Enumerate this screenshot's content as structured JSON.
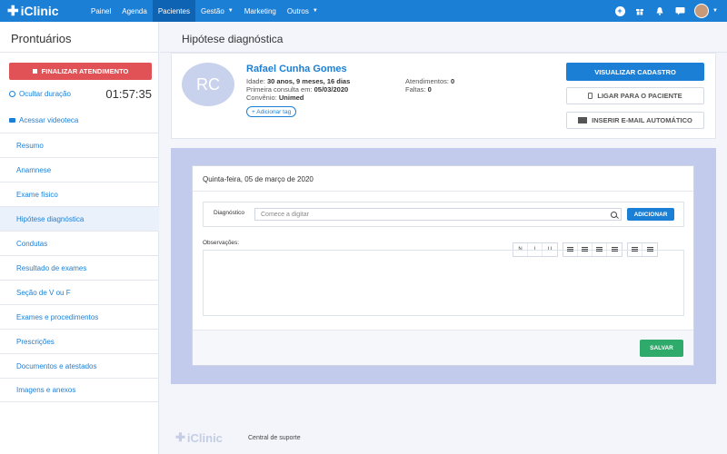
{
  "app": {
    "logo": "iClinic"
  },
  "nav": {
    "items": [
      {
        "label": "Painel"
      },
      {
        "label": "Agenda"
      },
      {
        "label": "Pacientes"
      },
      {
        "label": "Gestão"
      },
      {
        "label": "Marketing"
      },
      {
        "label": "Outros"
      }
    ],
    "active": "Pacientes"
  },
  "sidebar": {
    "title": "Prontuários",
    "finish_label": "FINALIZAR ATENDIMENTO",
    "hide_duration_label": "Ocultar duração",
    "timer": "01:57:35",
    "video_label": "Acessar videoteca",
    "items": [
      {
        "label": "Resumo"
      },
      {
        "label": "Anamnese"
      },
      {
        "label": "Exame físico"
      },
      {
        "label": "Hipótese diagnóstica"
      },
      {
        "label": "Condutas"
      },
      {
        "label": "Resultado de exames"
      },
      {
        "label": "Seção de V ou F"
      },
      {
        "label": "Exames e procedimentos"
      },
      {
        "label": "Prescrições"
      },
      {
        "label": "Documentos e atestados"
      },
      {
        "label": "Imagens e anexos"
      }
    ],
    "active": "Hipótese diagnóstica"
  },
  "page": {
    "title": "Hipótese diagnóstica"
  },
  "patient": {
    "initials": "RC",
    "name": "Rafael Cunha Gomes",
    "age_label": "Idade:",
    "age_value": "30 anos, 9 meses, 16 dias",
    "first_visit_label": "Primeira consulta em:",
    "first_visit_value": "05/03/2020",
    "insurance_label": "Convênio:",
    "insurance_value": "Unimed",
    "add_tag_label": "+ Adicionar tag",
    "appointments_label": "Atendimentos:",
    "appointments_value": "0",
    "absences_label": "Faltas:",
    "absences_value": "0",
    "view_record_label": "VISUALIZAR CADASTRO",
    "call_label": "LIGAR PARA O PACIENTE",
    "email_label": "INSERIR E-MAIL AUTOMÁTICO"
  },
  "form": {
    "date": "Quinta-feira, 05 de março de 2020",
    "diagnosis_label": "Diagnóstico",
    "diagnosis_placeholder": "Comece a digitar",
    "add_label": "ADICIONAR",
    "observations_label": "Observações:",
    "toolbar": {
      "bold": "N",
      "italic": "I",
      "underline": "U"
    },
    "save_label": "SALVAR"
  },
  "footer": {
    "logo": "iClinic",
    "support_label": "Central de suporte"
  },
  "colors": {
    "primary": "#1b7fd6",
    "danger": "#e05255",
    "success": "#2eaa6b",
    "panel": "#c2cbec"
  }
}
